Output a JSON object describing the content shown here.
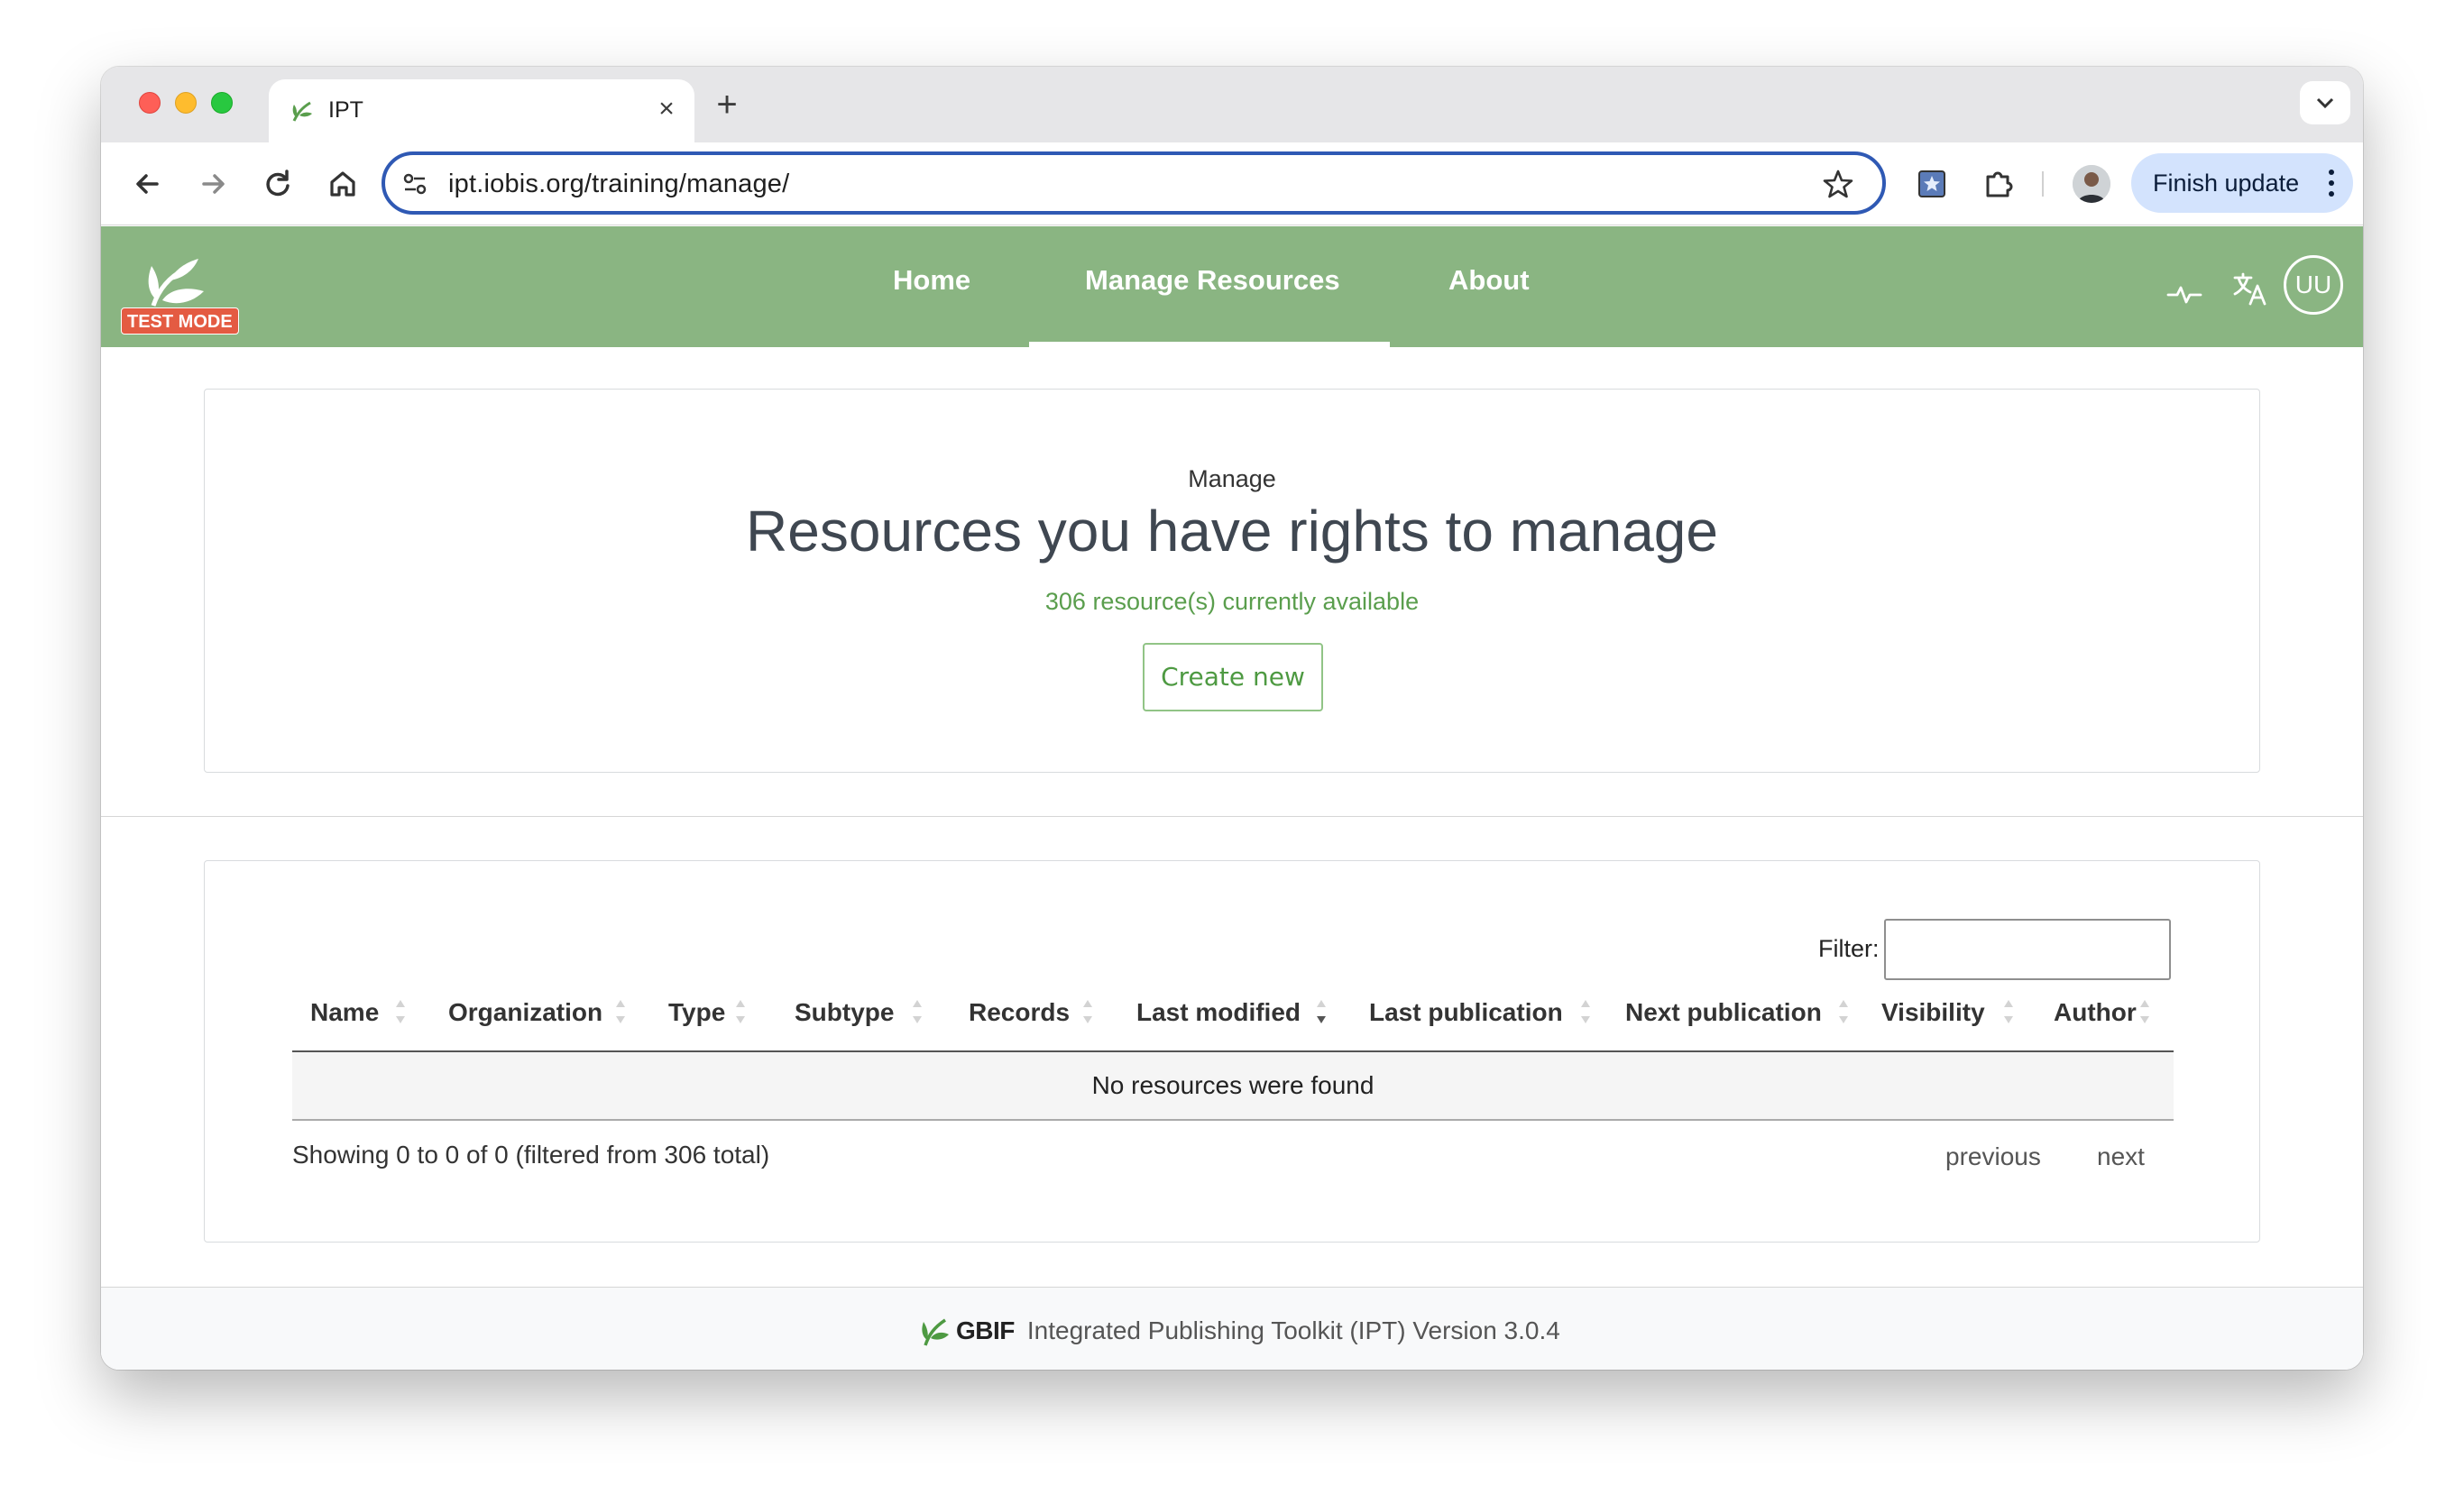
{
  "browser": {
    "tab_title": "IPT",
    "tab_close": "×",
    "new_tab": "+",
    "url": "ipt.iobis.org/training/manage/",
    "finish_update": "Finish update"
  },
  "navbar": {
    "test_mode": "TEST MODE",
    "items": [
      {
        "label": "Home",
        "active": false
      },
      {
        "label": "Manage Resources",
        "active": true
      },
      {
        "label": "About",
        "active": false
      }
    ],
    "user_initials": "UU",
    "colors": {
      "navbar_bg": "#8ab582",
      "test_mode_bg": "#e45b42"
    }
  },
  "header": {
    "eyebrow": "Manage",
    "title": "Resources you have rights to manage",
    "subtitle": "306 resource(s) currently available",
    "create_button": "Create new"
  },
  "table": {
    "filter_label": "Filter:",
    "filter_value": "",
    "columns": [
      "Name",
      "Organization",
      "Type",
      "Subtype",
      "Records",
      "Last modified",
      "Last publication",
      "Next publication",
      "Visibility",
      "Author"
    ],
    "sorted_column": "Last modified",
    "sort_direction": "descending",
    "empty_message": "No resources were found",
    "info": "Showing 0 to 0 of 0 (filtered from 306 total)",
    "pagination": {
      "previous": "previous",
      "next": "next"
    }
  },
  "footer": {
    "brand": "GBIF",
    "text": "Integrated Publishing Toolkit (IPT) Version 3.0.4"
  }
}
